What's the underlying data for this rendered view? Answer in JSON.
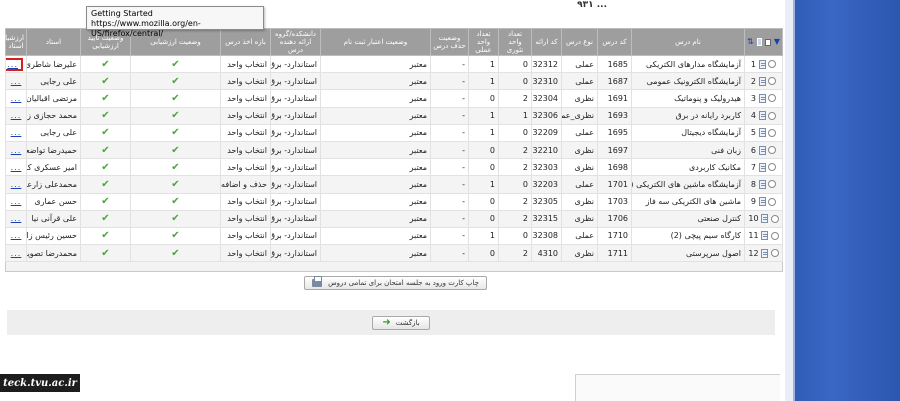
{
  "header": {
    "partial_title": "... ۹۳۱"
  },
  "tooltip": {
    "title": "Getting Started",
    "url": "https://www.mozilla.org/en-US/firefox/central/"
  },
  "table": {
    "columns": {
      "name": "نام درس",
      "code": "کد درس",
      "type": "نوع درس",
      "group": "کد ارائه",
      "units_theory": "تعداد واحد تئوری",
      "units_practical": "تعداد واحد عملی",
      "drop_status": "وضعیت حذف درس",
      "credit_status": "وضعیت اعتبار ثبت نام",
      "faculty": "دانشکده/گروه ارائه دهنده درس",
      "enroll_stage": "بازه اخذ درس",
      "eval_status": "وضعیت ارزشیابی",
      "eval_confirm": "وضعیت تایید ارزشیابی",
      "teacher": "استاد",
      "evaluation": "ارزشیابی استاد"
    },
    "rows": [
      {
        "num": "1",
        "name": "آزمایشگاه مدارهای الکتریکی",
        "code": "1685",
        "type": "عملی",
        "group": "32312",
        "units_theory": "0",
        "units_practical": "1",
        "drop": "-",
        "credit": "معتبر",
        "faculty": "استاندارد- برق و کامپیوتر",
        "stage": "انتخاب واحد",
        "teacher": "علیرضا شاطری",
        "eval": "..."
      },
      {
        "num": "2",
        "name": "آزمایشگاه الکترونیک عمومی",
        "code": "1687",
        "type": "عملی",
        "group": "32310",
        "units_theory": "0",
        "units_practical": "1",
        "drop": "-",
        "credit": "معتبر",
        "faculty": "استاندارد- برق و کامپیوتر",
        "stage": "انتخاب واحد",
        "teacher": "علی رجایی",
        "eval": "..."
      },
      {
        "num": "3",
        "name": "هیدرولیک و پنوماتیک",
        "code": "1691",
        "type": "نظری",
        "group": "32304",
        "units_theory": "2",
        "units_practical": "0",
        "drop": "-",
        "credit": "معتبر",
        "faculty": "استاندارد- برق و کامپیوتر",
        "stage": "انتخاب واحد",
        "teacher": "مرتضی اقبالیان",
        "eval": "..."
      },
      {
        "num": "4",
        "name": "کاربرد رایانه در برق",
        "code": "1693",
        "type": "نظری_عملی",
        "group": "32306",
        "units_theory": "1",
        "units_practical": "1",
        "drop": "-",
        "credit": "معتبر",
        "faculty": "استاندارد- برق و کامپیوتر",
        "stage": "انتخاب واحد",
        "teacher": "محمد حجازی زاده",
        "eval": "..."
      },
      {
        "num": "5",
        "name": "آزمایشگاه دیجیتال",
        "code": "1695",
        "type": "عملی",
        "group": "32209",
        "units_theory": "0",
        "units_practical": "1",
        "drop": "-",
        "credit": "معتبر",
        "faculty": "استاندارد- برق و کامپیوتر",
        "stage": "انتخاب واحد",
        "teacher": "علی رجایی",
        "eval": "..."
      },
      {
        "num": "6",
        "name": "زبان فنی",
        "code": "1697",
        "type": "نظری",
        "group": "32210",
        "units_theory": "2",
        "units_practical": "0",
        "drop": "-",
        "credit": "معتبر",
        "faculty": "استاندارد- برق و کامپیوتر",
        "stage": "انتخاب واحد",
        "teacher": "حمیدرضا تواضعی",
        "eval": "..."
      },
      {
        "num": "7",
        "name": "مکانیک کاربردی",
        "code": "1698",
        "type": "نظری",
        "group": "32303",
        "units_theory": "2",
        "units_practical": "0",
        "drop": "-",
        "credit": "معتبر",
        "faculty": "استاندارد- برق و کامپیوتر",
        "stage": "انتخاب واحد",
        "teacher": "امیر عسکری کاشان",
        "eval": "..."
      },
      {
        "num": "8",
        "name": "آزمایشگاه ماشین های الکتریکی (1)",
        "code": "1701",
        "type": "عملی",
        "group": "32203",
        "units_theory": "0",
        "units_practical": "1",
        "drop": "-",
        "credit": "معتبر",
        "faculty": "استاندارد- برق و کامپیوتر",
        "stage": "حذف و اضافه",
        "teacher": "محمدعلی زارعی",
        "eval": "..."
      },
      {
        "num": "9",
        "name": "ماشین های الکتریکی سه فاز",
        "code": "1703",
        "type": "نظری",
        "group": "32305",
        "units_theory": "2",
        "units_practical": "0",
        "drop": "-",
        "credit": "معتبر",
        "faculty": "استاندارد- برق و کامپیوتر",
        "stage": "انتخاب واحد",
        "teacher": "حسن عماری",
        "eval": "..."
      },
      {
        "num": "10",
        "name": "کنترل صنعتی",
        "code": "1706",
        "type": "نظری",
        "group": "32315",
        "units_theory": "2",
        "units_practical": "0",
        "drop": "-",
        "credit": "معتبر",
        "faculty": "استاندارد- برق و کامپیوتر",
        "stage": "انتخاب واحد",
        "teacher": "علی قرآنی نیا",
        "eval": "..."
      },
      {
        "num": "11",
        "name": "کارگاه سیم پیچی (2)",
        "code": "1710",
        "type": "عملی",
        "group": "32308",
        "units_theory": "0",
        "units_practical": "1",
        "drop": "-",
        "credit": "معتبر",
        "faculty": "استاندارد- برق و کامپیوتر",
        "stage": "انتخاب واحد",
        "teacher": "حسین رئیس زاده فردبیدگلی",
        "eval": "..."
      },
      {
        "num": "12",
        "name": "اصول سرپرستی",
        "code": "1711",
        "type": "نظری",
        "group": "4310",
        "units_theory": "2",
        "units_practical": "0",
        "drop": "-",
        "credit": "معتبر",
        "faculty": "استاندارد- برق و کامپیوتر",
        "stage": "انتخاب واحد",
        "teacher": "محمدرضا تصویری",
        "eval": "..."
      }
    ]
  },
  "buttons": {
    "print_label": "چاپ کارت ورود به جلسه امتحان برای تمامی دروس",
    "back_label": "بازگشت"
  },
  "watermark": {
    "text": "teck.tvu.ac.ir"
  },
  "colors": {
    "header_bg": "#9e9e9e",
    "check_green": "#4aa63a",
    "link_blue": "#1a3fb0",
    "highlight_red": "#d81e1e",
    "side_blue": "#2f5db8"
  }
}
